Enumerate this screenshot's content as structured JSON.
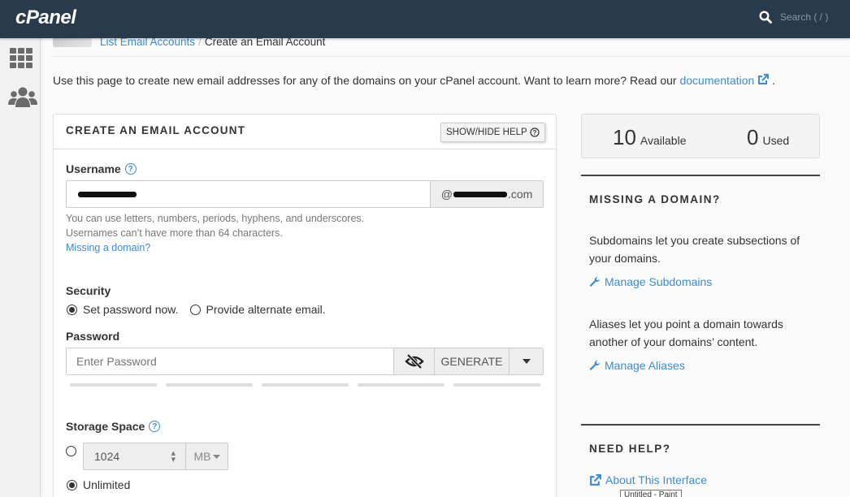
{
  "header": {
    "logo": "cPanel",
    "search_placeholder": "Search ( / )"
  },
  "sidebar": {
    "items": [
      {
        "icon": "grid-icon",
        "label": "Tools"
      },
      {
        "icon": "users-icon",
        "label": "Users"
      }
    ]
  },
  "breadcrumb": {
    "parent": "List Email Accounts",
    "separator": "/",
    "current": "Create an Email Account"
  },
  "intro": {
    "text": "Use this page to create new email addresses for any of the domains on your cPanel account. Want to learn more? Read our ",
    "link": "documentation",
    "suffix": " ."
  },
  "form": {
    "title": "CREATE AN EMAIL ACCOUNT",
    "help_button": "SHOW/HIDE HELP",
    "username": {
      "label": "Username",
      "value": "[redacted]",
      "domain_prefix": "@",
      "domain_suffix": ".com",
      "hints": [
        "You can use letters, numbers, periods, hyphens, and underscores.",
        "Usernames can’t have more than 64 characters."
      ],
      "missing_domain_link": "Missing a domain?"
    },
    "security": {
      "label": "Security",
      "options": [
        {
          "label": "Set password now.",
          "selected": true
        },
        {
          "label": "Provide alternate email.",
          "selected": false
        }
      ]
    },
    "password": {
      "label": "Password",
      "placeholder": "Enter Password",
      "value": "",
      "generate_label": "GENERATE",
      "strength_segments": 5,
      "strength_filled": 0
    },
    "storage": {
      "label": "Storage Space",
      "quota_value": "1024",
      "unit": "MB",
      "quota_selected": false,
      "unlimited_label": "Unlimited",
      "unlimited_selected": true
    }
  },
  "stats": {
    "available_count": "10",
    "available_label": "Available",
    "used_count": "0",
    "used_label": "Used"
  },
  "missing_domain": {
    "heading": "MISSING A DOMAIN?",
    "subdomains_text": "Subdomains let you create subsections of your domains.",
    "subdomains_link": "Manage Subdomains",
    "aliases_text": "Aliases let you point a domain towards another of your domains’ content.",
    "aliases_link": "Manage Aliases"
  },
  "need_help": {
    "heading": "NEED HELP?",
    "about_link": "About This Interface"
  },
  "tooltip": {
    "text": "Untitled - Paint"
  },
  "colors": {
    "header_bg": "#293a4a",
    "link": "#3d8bd1",
    "text": "#333333"
  }
}
